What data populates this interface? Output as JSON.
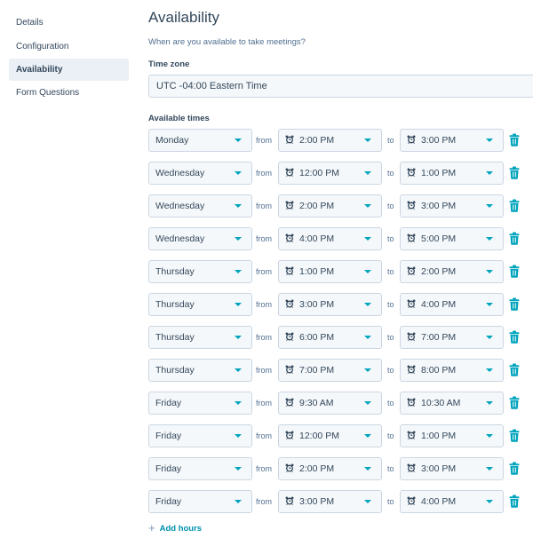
{
  "sidebar": {
    "items": [
      {
        "label": "Details",
        "active": false
      },
      {
        "label": "Configuration",
        "active": false
      },
      {
        "label": "Availability",
        "active": true
      },
      {
        "label": "Form Questions",
        "active": false
      }
    ]
  },
  "main": {
    "title": "Availability",
    "subtitle": "When are you available to take meetings?",
    "timezone_label": "Time zone",
    "timezone_value": "UTC -04:00 Eastern Time",
    "available_times_label": "Available times",
    "from_label": "from",
    "to_label": "to",
    "add_hours_label": "Add hours",
    "icons": {
      "select_caret": "caret-down-icon",
      "time": "alarm-clock-icon",
      "delete": "trash-icon",
      "add": "plus-icon"
    },
    "accent_color": "#00a4bd",
    "rows": [
      {
        "day": "Monday",
        "from": "2:00 PM",
        "to": "3:00 PM"
      },
      {
        "day": "Wednesday",
        "from": "12:00 PM",
        "to": "1:00 PM"
      },
      {
        "day": "Wednesday",
        "from": "2:00 PM",
        "to": "3:00 PM"
      },
      {
        "day": "Wednesday",
        "from": "4:00 PM",
        "to": "5:00 PM"
      },
      {
        "day": "Thursday",
        "from": "1:00 PM",
        "to": "2:00 PM"
      },
      {
        "day": "Thursday",
        "from": "3:00 PM",
        "to": "4:00 PM"
      },
      {
        "day": "Thursday",
        "from": "6:00 PM",
        "to": "7:00 PM"
      },
      {
        "day": "Thursday",
        "from": "7:00 PM",
        "to": "8:00 PM"
      },
      {
        "day": "Friday",
        "from": "9:30 AM",
        "to": "10:30 AM"
      },
      {
        "day": "Friday",
        "from": "12:00 PM",
        "to": "1:00 PM"
      },
      {
        "day": "Friday",
        "from": "2:00 PM",
        "to": "3:00 PM"
      },
      {
        "day": "Friday",
        "from": "3:00 PM",
        "to": "4:00 PM"
      }
    ]
  }
}
